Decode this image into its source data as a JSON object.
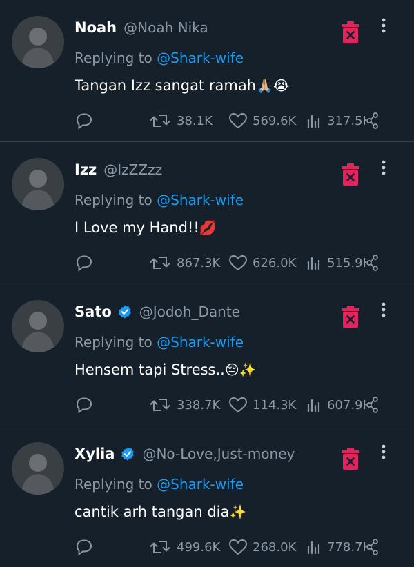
{
  "replying_label": "Replying to",
  "tweets": [
    {
      "name": "Noah",
      "handle": "@Noah Nika",
      "verified": false,
      "reply_to": "@Shark-wife",
      "text": "Tangan Izz sangat ramah",
      "emoji": "🙏🏼😭",
      "retweets": "38.1K",
      "likes": "569.6K",
      "views": "317.5K"
    },
    {
      "name": "Izz",
      "handle": "@IzZZzz",
      "verified": false,
      "reply_to": "@Shark-wife",
      "text": "I Love my Hand!!",
      "emoji": "💋",
      "retweets": "867.3K",
      "likes": "626.0K",
      "views": "515.9K"
    },
    {
      "name": "Sato",
      "handle": "@Jodoh_Dante",
      "verified": true,
      "reply_to": "@Shark-wife",
      "text": "Hensem tapi Stress..",
      "emoji": "😔✨",
      "retweets": "338.7K",
      "likes": "114.3K",
      "views": "607.9K"
    },
    {
      "name": "Xylia",
      "handle": "@No-Love,Just-money",
      "verified": true,
      "reply_to": "@Shark-wife",
      "text": "cantik arh tangan dia",
      "emoji": "✨",
      "retweets": "499.6K",
      "likes": "268.0K",
      "views": "778.7K"
    }
  ],
  "colors": {
    "background": "#15202b",
    "secondary_text": "#8b98a5",
    "accent": "#1d9bf0",
    "delete_icon": "#e0245e",
    "divider": "#38444d"
  }
}
